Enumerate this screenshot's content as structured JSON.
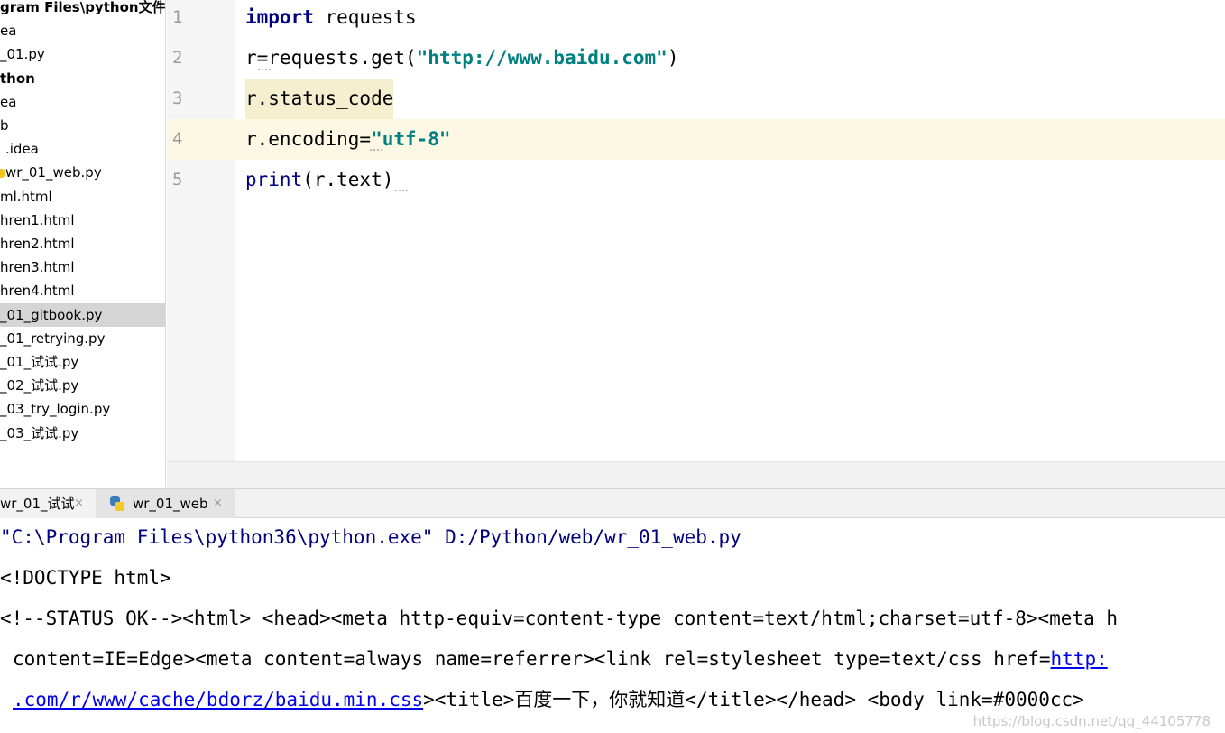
{
  "project_tree": [
    {
      "label": "gram Files\\python文件",
      "bold": true,
      "selected": false,
      "icon": "none"
    },
    {
      "label": "ea",
      "bold": false,
      "selected": false,
      "icon": "none"
    },
    {
      "label": "_01.py",
      "bold": false,
      "selected": false,
      "icon": "none"
    },
    {
      "label": "thon",
      "bold": true,
      "selected": false,
      "icon": "none"
    },
    {
      "label": "ea",
      "bold": false,
      "selected": false,
      "icon": "none"
    },
    {
      "label": "b",
      "bold": false,
      "selected": false,
      "icon": "none"
    },
    {
      "label": ".idea",
      "bold": false,
      "selected": false,
      "icon": "none"
    },
    {
      "label": "wr_01_web.py",
      "bold": false,
      "selected": false,
      "icon": "python-file-icon"
    },
    {
      "label": "ml.html",
      "bold": false,
      "selected": false,
      "icon": "none"
    },
    {
      "label": "hren1.html",
      "bold": false,
      "selected": false,
      "icon": "none"
    },
    {
      "label": "hren2.html",
      "bold": false,
      "selected": false,
      "icon": "none"
    },
    {
      "label": "hren3.html",
      "bold": false,
      "selected": false,
      "icon": "none"
    },
    {
      "label": "hren4.html",
      "bold": false,
      "selected": false,
      "icon": "none"
    },
    {
      "label": "_01_gitbook.py",
      "bold": false,
      "selected": true,
      "icon": "none"
    },
    {
      "label": "_01_retrying.py",
      "bold": false,
      "selected": false,
      "icon": "none"
    },
    {
      "label": "_01_试试.py",
      "bold": false,
      "selected": false,
      "icon": "none"
    },
    {
      "label": "_02_试试.py",
      "bold": false,
      "selected": false,
      "icon": "none"
    },
    {
      "label": "_03_try_login.py",
      "bold": false,
      "selected": false,
      "icon": "none"
    },
    {
      "label": "_03_试试.py",
      "bold": false,
      "selected": false,
      "icon": "none"
    }
  ],
  "editor": {
    "line_numbers": [
      "1",
      "2",
      "3",
      "4",
      "5"
    ],
    "caret_line": 4,
    "lines": [
      [
        {
          "t": "import",
          "c": "kw"
        },
        {
          "t": " requests",
          "c": ""
        }
      ],
      [
        {
          "t": "r=requests.get(",
          "c": ""
        },
        {
          "t": "\"http://www.baidu.com\"",
          "c": "str"
        },
        {
          "t": ")",
          "c": ""
        }
      ],
      [
        {
          "t": "r.status_code",
          "c": "hl"
        }
      ],
      [
        {
          "t": "r.encoding=",
          "c": ""
        },
        {
          "t": "\"utf-8\"",
          "c": "str"
        }
      ],
      [
        {
          "t": "print",
          "c": "kw-builtin"
        },
        {
          "t": "(r.text)",
          "c": ""
        }
      ]
    ]
  },
  "run_tabs": [
    {
      "label": "wr_01_试试",
      "active": true,
      "icon": "none",
      "close": "×"
    },
    {
      "label": "wr_01_web",
      "active": false,
      "icon": "python-logo-icon",
      "close": "×"
    }
  ],
  "console": [
    {
      "cls": "cmd",
      "parts": [
        {
          "t": "\"C:\\Program Files\\python36\\python.exe\" D:/Python/web/wr_01_web.py",
          "c": ""
        }
      ]
    },
    {
      "cls": "",
      "parts": [
        {
          "t": "<!DOCTYPE html>",
          "c": ""
        }
      ]
    },
    {
      "cls": "",
      "parts": [
        {
          "t": "<!--STATUS OK--><html> <head><meta http-equiv=content-type content=text/html;charset=utf-8><meta h",
          "c": ""
        }
      ]
    },
    {
      "cls": "indent",
      "parts": [
        {
          "t": "content=IE=Edge><meta content=always name=referrer><link rel=stylesheet type=text/css href=",
          "c": ""
        },
        {
          "t": "http:",
          "c": "link"
        }
      ]
    },
    {
      "cls": "indent",
      "parts": [
        {
          "t": ".com/r/www/cache/bdorz/baidu.min.css",
          "c": "link"
        },
        {
          "t": "><title>",
          "c": ""
        },
        {
          "t": "百度一下，你就知道",
          "c": "cjk"
        },
        {
          "t": "</title></head> <body link=#0000cc>",
          "c": ""
        }
      ]
    }
  ],
  "watermark": "https://blog.csdn.net/qq_44105778",
  "colors": {
    "keyword": "#000080",
    "string": "#008080",
    "caret_row": "#fdf8e4",
    "selection": "#d5d5d5",
    "link": "#0000ee"
  }
}
